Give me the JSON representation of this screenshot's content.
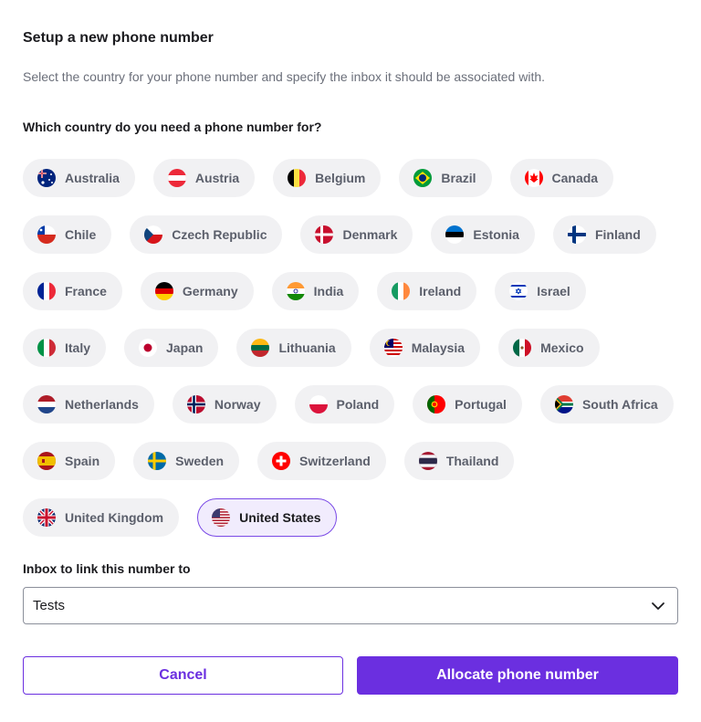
{
  "dialog": {
    "title": "Setup a new phone number",
    "subtitle": "Select the country for your phone number and specify the inbox it should be associated with.",
    "question": "Which country do you need a phone number for?"
  },
  "countries": [
    {
      "label": "Australia",
      "flag": "au-flag-icon"
    },
    {
      "label": "Austria",
      "flag": "at-flag-icon"
    },
    {
      "label": "Belgium",
      "flag": "be-flag-icon"
    },
    {
      "label": "Brazil",
      "flag": "br-flag-icon"
    },
    {
      "label": "Canada",
      "flag": "ca-flag-icon"
    },
    {
      "label": "Chile",
      "flag": "cl-flag-icon"
    },
    {
      "label": "Czech Republic",
      "flag": "cz-flag-icon"
    },
    {
      "label": "Denmark",
      "flag": "dk-flag-icon"
    },
    {
      "label": "Estonia",
      "flag": "ee-flag-icon"
    },
    {
      "label": "Finland",
      "flag": "fi-flag-icon"
    },
    {
      "label": "France",
      "flag": "fr-flag-icon"
    },
    {
      "label": "Germany",
      "flag": "de-flag-icon"
    },
    {
      "label": "India",
      "flag": "in-flag-icon"
    },
    {
      "label": "Ireland",
      "flag": "ie-flag-icon"
    },
    {
      "label": "Israel",
      "flag": "il-flag-icon"
    },
    {
      "label": "Italy",
      "flag": "it-flag-icon"
    },
    {
      "label": "Japan",
      "flag": "jp-flag-icon"
    },
    {
      "label": "Lithuania",
      "flag": "lt-flag-icon"
    },
    {
      "label": "Malaysia",
      "flag": "my-flag-icon"
    },
    {
      "label": "Mexico",
      "flag": "mx-flag-icon"
    },
    {
      "label": "Netherlands",
      "flag": "nl-flag-icon"
    },
    {
      "label": "Norway",
      "flag": "no-flag-icon"
    },
    {
      "label": "Poland",
      "flag": "pl-flag-icon"
    },
    {
      "label": "Portugal",
      "flag": "pt-flag-icon"
    },
    {
      "label": "South Africa",
      "flag": "za-flag-icon"
    },
    {
      "label": "Spain",
      "flag": "es-flag-icon"
    },
    {
      "label": "Sweden",
      "flag": "se-flag-icon"
    },
    {
      "label": "Switzerland",
      "flag": "ch-flag-icon"
    },
    {
      "label": "Thailand",
      "flag": "th-flag-icon"
    },
    {
      "label": "United Kingdom",
      "flag": "gb-flag-icon"
    },
    {
      "label": "United States",
      "flag": "us-flag-icon"
    }
  ],
  "selected_country": "United States",
  "inbox": {
    "label": "Inbox to link this number to",
    "selected_value": "Tests"
  },
  "buttons": {
    "cancel": "Cancel",
    "allocate": "Allocate phone number"
  },
  "colors": {
    "accent": "#6b2fe0",
    "chip_bg": "#f1f1f3",
    "chip_selected_bg": "#f1ecfd"
  }
}
